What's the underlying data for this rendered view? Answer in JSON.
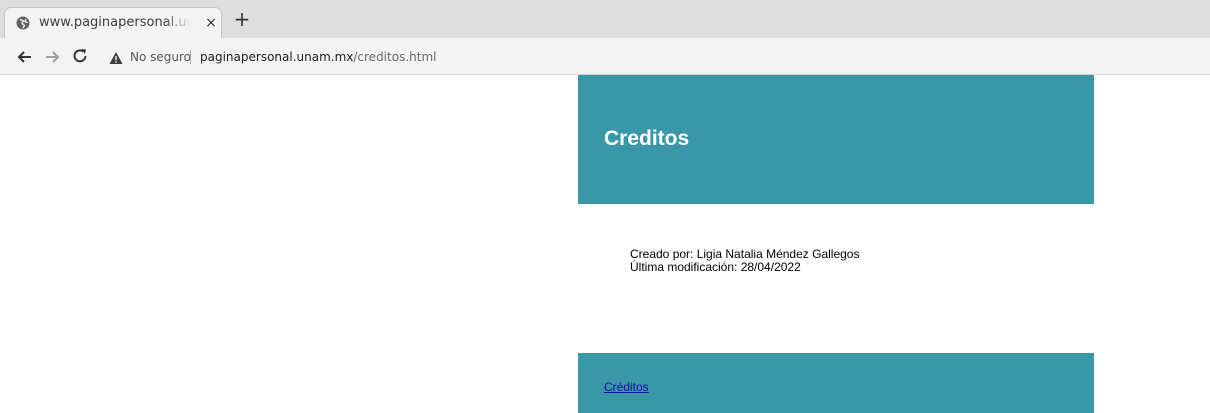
{
  "browser": {
    "tab": {
      "title": "www.paginapersonal.unam.mx/creditos.html",
      "favicon": "globe-icon",
      "close_label": "×"
    },
    "new_tab_label": "+",
    "toolbar": {
      "back_icon": "arrow-left-icon",
      "forward_icon": "arrow-right-icon",
      "reload_icon": "reload-icon",
      "security_icon": "warning-triangle-icon",
      "security_label": "No seguro",
      "url_host": "paginapersonal.unam.mx",
      "url_path": "/creditos.html"
    }
  },
  "page": {
    "header": {
      "title": "Creditos",
      "background": "#3a97a8"
    },
    "credits": {
      "created_by": "Creado por: Ligia Natalia Méndez Gallegos",
      "last_modified": "Última modificación: 28/04/2022"
    },
    "footer": {
      "link_label": "Créditos",
      "background": "#3a97a8"
    }
  }
}
